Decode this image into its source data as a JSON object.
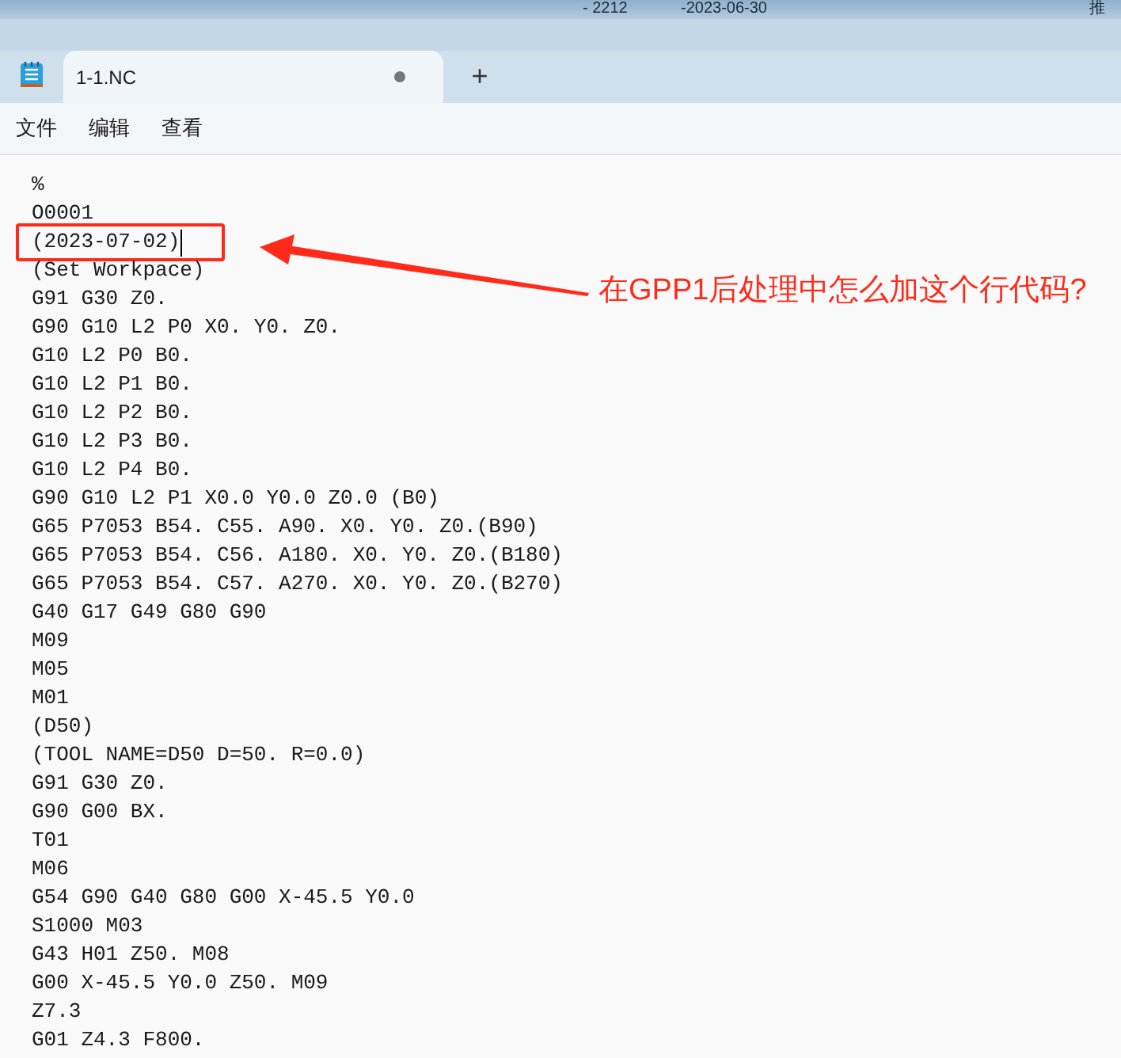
{
  "desktop_bar": {
    "texts": [
      "- 2212",
      "-2023-06-30",
      "推"
    ]
  },
  "tabs": [
    {
      "label": "1-1.NC",
      "selected": true,
      "unsaved": true
    }
  ],
  "new_tab": "+",
  "menu": [
    "文件",
    "编辑",
    "查看"
  ],
  "editor": {
    "lines": [
      "%",
      "O0001",
      {
        "text": "(2023-07-02)",
        "cursor": true,
        "framed": true
      },
      "(Set Workpace)",
      "G91 G30 Z0.",
      "G90 G10 L2 P0 X0. Y0. Z0.",
      "G10 L2 P0 B0.",
      "G10 L2 P1 B0.",
      "G10 L2 P2 B0.",
      "G10 L2 P3 B0.",
      "G10 L2 P4 B0.",
      "G90 G10 L2 P1 X0.0 Y0.0 Z0.0 (B0)",
      "G65 P7053 B54. C55. A90. X0. Y0. Z0.(B90)",
      "G65 P7053 B54. C56. A180. X0. Y0. Z0.(B180)",
      "G65 P7053 B54. C57. A270. X0. Y0. Z0.(B270)",
      "G40 G17 G49 G80 G90",
      "M09",
      "M05",
      "M01",
      "(D50)",
      "(TOOL NAME=D50 D=50. R=0.0)",
      "G91 G30 Z0.",
      "G90 G00 BX.",
      "T01",
      "M06",
      "G54 G90 G40 G80 G00 X-45.5 Y0.0",
      "S1000 M03",
      "G43 H01 Z50. M08",
      "G00 X-45.5 Y0.0 Z50. M09",
      "Z7.3",
      "G01 Z4.3 F800."
    ]
  },
  "annotation": {
    "text": "在GPP1后处理中怎么加这个行代码?"
  }
}
